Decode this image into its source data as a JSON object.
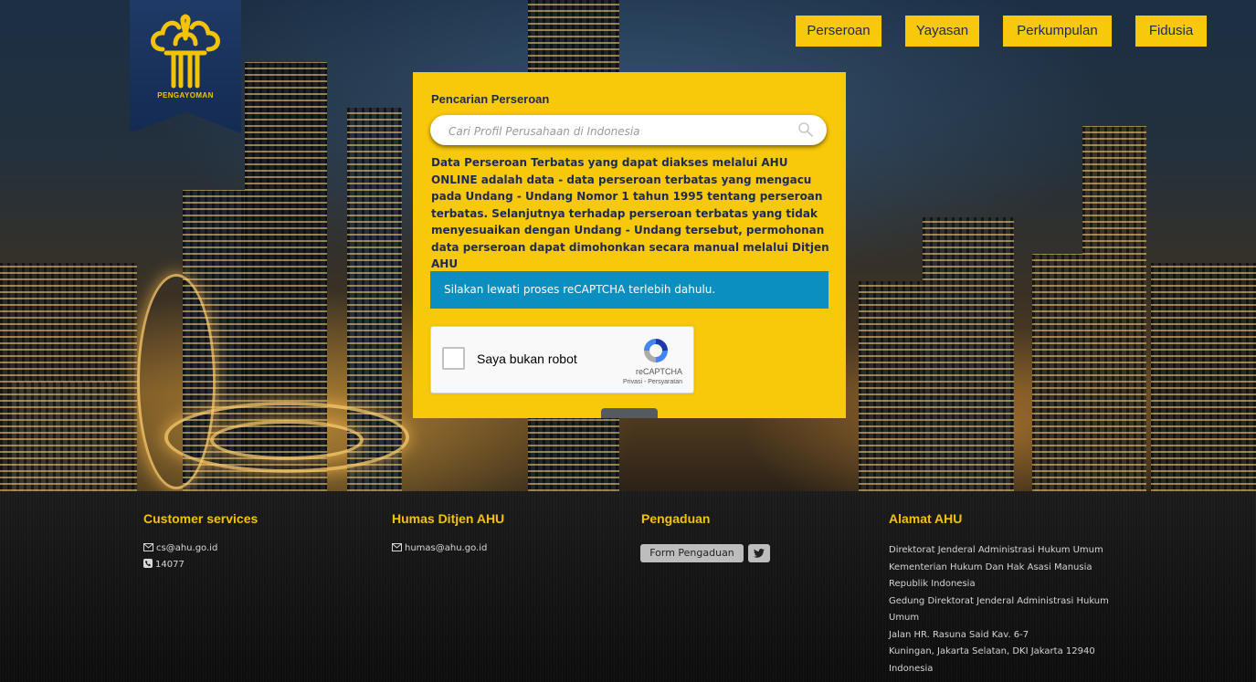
{
  "logo": {
    "text": "PENGAYOMAN"
  },
  "nav": {
    "items": [
      {
        "label": "Perseroan"
      },
      {
        "label": "Yayasan"
      },
      {
        "label": "Perkumpulan"
      },
      {
        "label": "Fidusia"
      }
    ]
  },
  "search_panel": {
    "title": "Pencarian Perseroan",
    "placeholder": "Cari Profil Perusahaan di Indonesia",
    "description": "Data Perseroan Terbatas yang dapat diakses melalui AHU ONLINE adalah data - data perseroan terbatas yang mengacu pada Undang - Undang Nomor 1 tahun 1995 tentang perseroan terbatas. Selanjutnya terhadap perseroan terbatas yang tidak menyesuaikan dengan Undang - Undang tersebut, permohonan data perseroan dapat dimohonkan secara manual melalui Ditjen AHU",
    "alert": "Silakan lewati proses reCAPTCHA terlebih dahulu."
  },
  "recaptcha": {
    "label": "Saya bukan robot",
    "brand": "reCAPTCHA",
    "terms": "Privasi - Persyaratan"
  },
  "colors": {
    "accent_yellow": "#f8c80a",
    "navy": "#1e2a55",
    "alert_blue": "#0b8fc1",
    "footer_heading": "#f5c400"
  },
  "footer": {
    "customer_services": {
      "title": "Customer services",
      "email": "cs@ahu.go.id",
      "phone": "14077"
    },
    "humas": {
      "title": "Humas Ditjen AHU",
      "email": "humas@ahu.go.id"
    },
    "pengaduan": {
      "title": "Pengaduan",
      "form_button": "Form Pengaduan"
    },
    "alamat": {
      "title": "Alamat AHU",
      "lines": [
        "Direktorat Jenderal Administrasi Hukum Umum",
        "Kementerian Hukum Dan Hak Asasi Manusia",
        "Republik Indonesia",
        "Gedung Direktorat Jenderal Administrasi Hukum",
        "Umum",
        "Jalan HR. Rasuna Said Kav. 6-7",
        "Kuningan, Jakarta Selatan, DKI Jakarta 12940",
        "Indonesia"
      ]
    }
  }
}
